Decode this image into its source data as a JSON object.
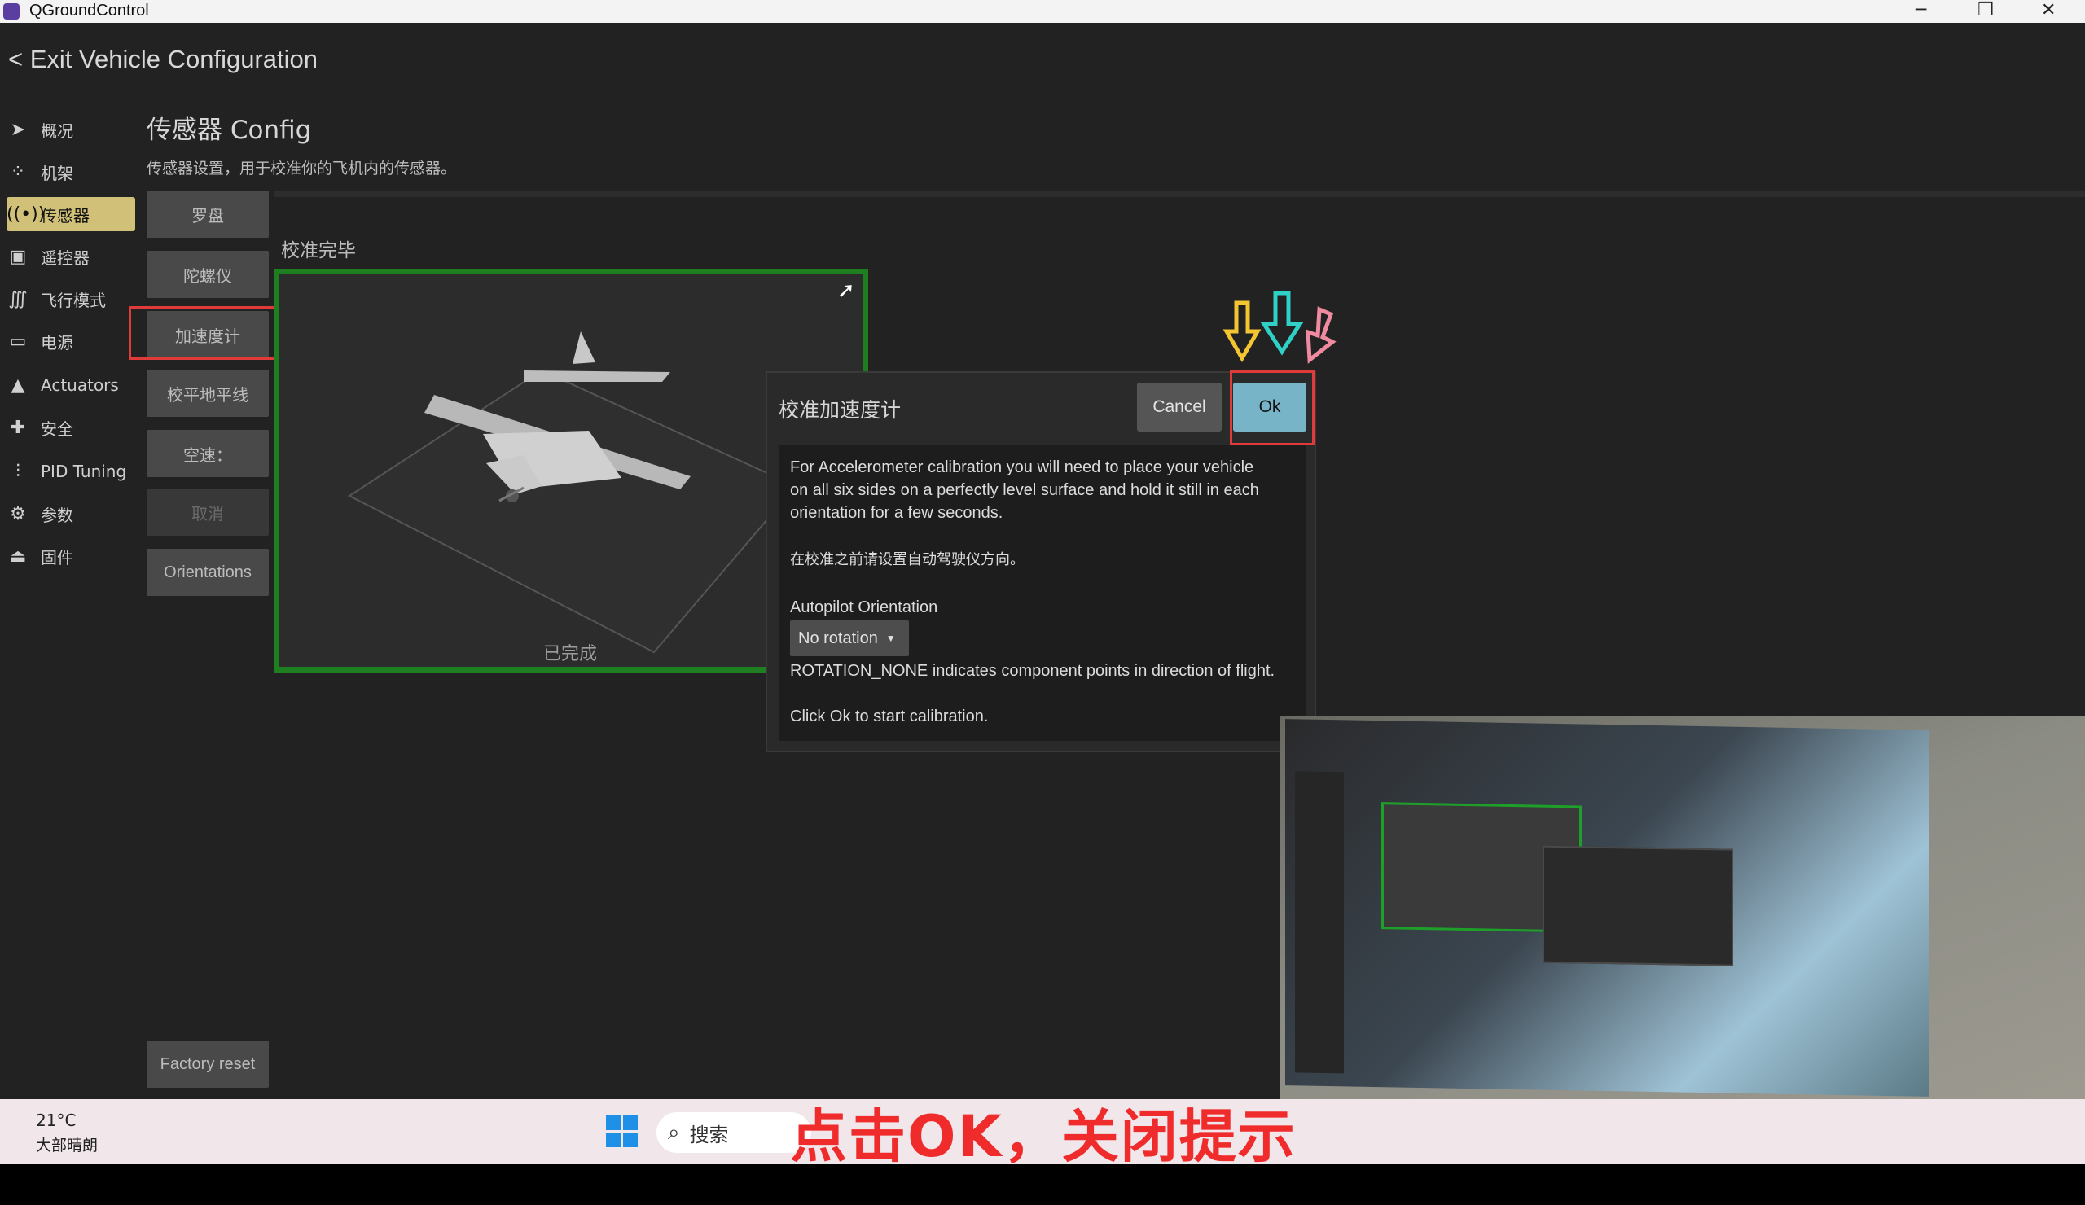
{
  "window": {
    "title": "QGroundControl"
  },
  "header": {
    "exit": "< Exit Vehicle Configuration"
  },
  "sidebar": {
    "items": [
      {
        "label": "概况",
        "icon": "paper-plane-icon"
      },
      {
        "label": "机架",
        "icon": "frame-icon"
      },
      {
        "label": "传感器",
        "icon": "sensor-icon",
        "active": true
      },
      {
        "label": "遥控器",
        "icon": "radio-icon"
      },
      {
        "label": "飞行模式",
        "icon": "wave-icon"
      },
      {
        "label": "电源",
        "icon": "battery-icon"
      },
      {
        "label": "Actuators",
        "icon": "actuator-icon"
      },
      {
        "label": "安全",
        "icon": "first-aid-icon"
      },
      {
        "label": "PID Tuning",
        "icon": "sliders-icon"
      },
      {
        "label": "参数",
        "icon": "gears-icon"
      },
      {
        "label": "固件",
        "icon": "firmware-icon"
      }
    ]
  },
  "page": {
    "title": "传感器 Config",
    "description": "传感器设置，用于校准你的飞机内的传感器。"
  },
  "sensor_buttons": [
    "罗盘",
    "陀螺仪",
    "加速度计",
    "校平地平线",
    "空速：",
    "取消",
    "Orientations"
  ],
  "factory_reset": "Factory reset",
  "calibration": {
    "status_label": "校准完毕",
    "done_label": "已完成"
  },
  "dialog": {
    "title": "校准加速度计",
    "cancel": "Cancel",
    "ok": "Ok",
    "line1": "For Accelerometer calibration you will need to place your vehicle",
    "line2": "on all six sides on a perfectly level surface and hold it still in each",
    "line3": "orientation for a few seconds.",
    "note": "在校准之前请设置自动驾驶仪方向。",
    "orientation_label": "Autopilot Orientation",
    "orientation_value": "No rotation",
    "rotation_note": "ROTATION_NONE indicates component points in direction of flight.",
    "click_ok": "Click Ok to start calibration."
  },
  "taskbar": {
    "temp": "21°C",
    "weather": "大部晴朗",
    "search_placeholder": "搜索"
  },
  "caption": "点击OK，关闭提示",
  "colors": {
    "accent": "#d0c078",
    "ok": "#78b4c8",
    "highlight": "#e03a3a",
    "panel_border": "#1e7f21"
  }
}
